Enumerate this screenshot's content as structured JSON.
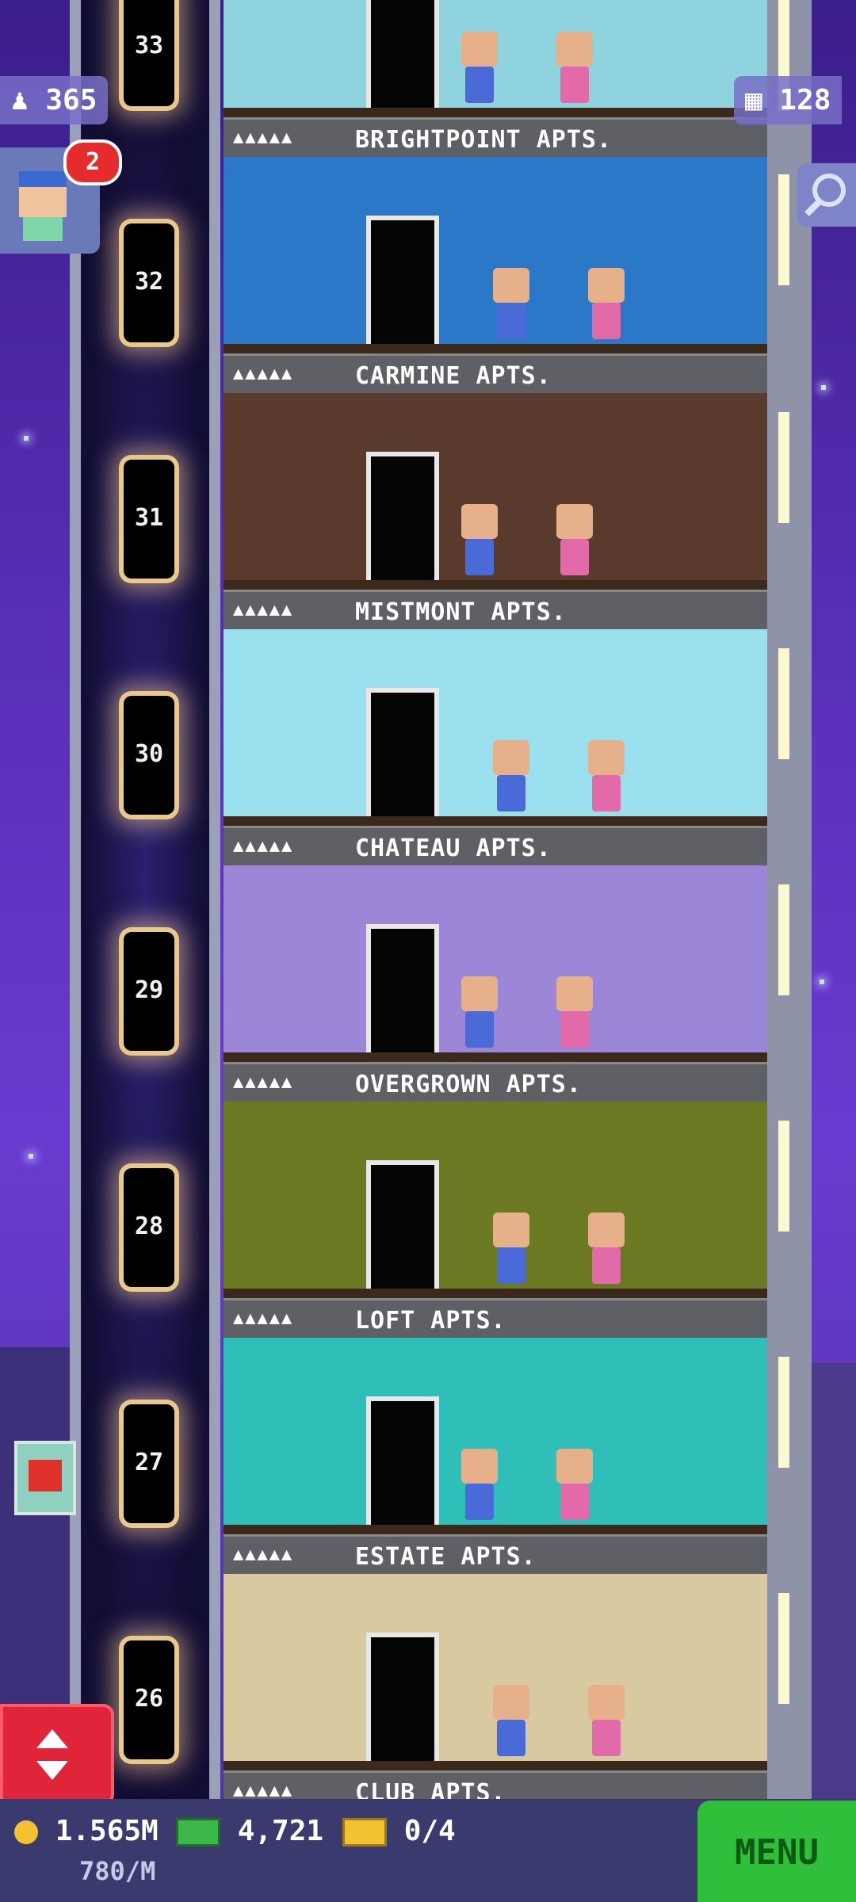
{
  "stats": {
    "residents": "365",
    "floors_count": "128",
    "notifications": "2"
  },
  "tower": {
    "floors": [
      {
        "number": "33",
        "name": "BRIGHTPOINT APTS.",
        "color": "#8fd3df"
      },
      {
        "number": "32",
        "name": "CARMINE APTS.",
        "color": "#2b78c9"
      },
      {
        "number": "31",
        "name": "MISTMONT APTS.",
        "color": "#5a3a2c"
      },
      {
        "number": "30",
        "name": "CHATEAU APTS.",
        "color": "#9be0ef"
      },
      {
        "number": "29",
        "name": "OVERGROWN APTS.",
        "color": "#9b86d8"
      },
      {
        "number": "28",
        "name": "LOFT APTS.",
        "color": "#6b7a22"
      },
      {
        "number": "27",
        "name": "ESTATE APTS.",
        "color": "#2fbfb8"
      },
      {
        "number": "26",
        "name": "CLUB APTS.",
        "color": "#d9c9a0"
      }
    ]
  },
  "bottom_bar": {
    "coins": "1.565M",
    "coin_rate": "780/M",
    "bux": "4,721",
    "tickets": "0/4",
    "menu_label": "MENU"
  },
  "icons": {
    "residents": "person-icon",
    "floors": "building-icon",
    "search": "magnifier-icon",
    "elevator": "elevator-arrows-icon",
    "coin": "coin-icon",
    "bux": "bux-icon",
    "ticket": "ticket-icon"
  }
}
